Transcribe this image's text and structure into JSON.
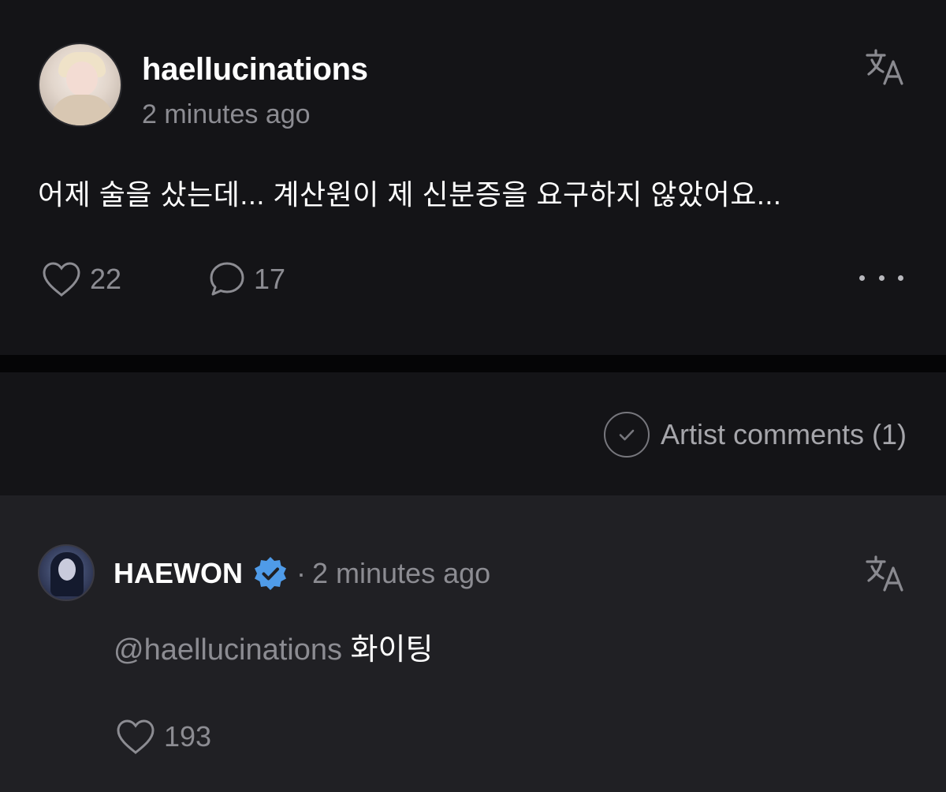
{
  "post": {
    "username": "haellucinations",
    "time": "2 minutes ago",
    "text": "어제 술을 샀는데... 계산원이 제 신분증을 요구하지 않았어요...",
    "likes": "22",
    "comments": "17"
  },
  "artist_comments": {
    "label": "Artist comments (1)"
  },
  "comment": {
    "username": "HAEWON",
    "separator": "·",
    "time": "2 minutes ago",
    "mention": "@haellucinations",
    "text": "화이팅",
    "likes": "193"
  },
  "icons": {
    "translate": "translate-icon",
    "like": "heart-outline-icon",
    "comment": "speech-bubble-icon",
    "more": "more-horizontal-icon",
    "check": "check-circle-icon",
    "verified": "verified-badge-icon"
  },
  "colors": {
    "background": "#141417",
    "comment_background": "#202024",
    "divider": "#050506",
    "muted_text": "#8c8c92",
    "verified_badge": "#4f9be8"
  }
}
